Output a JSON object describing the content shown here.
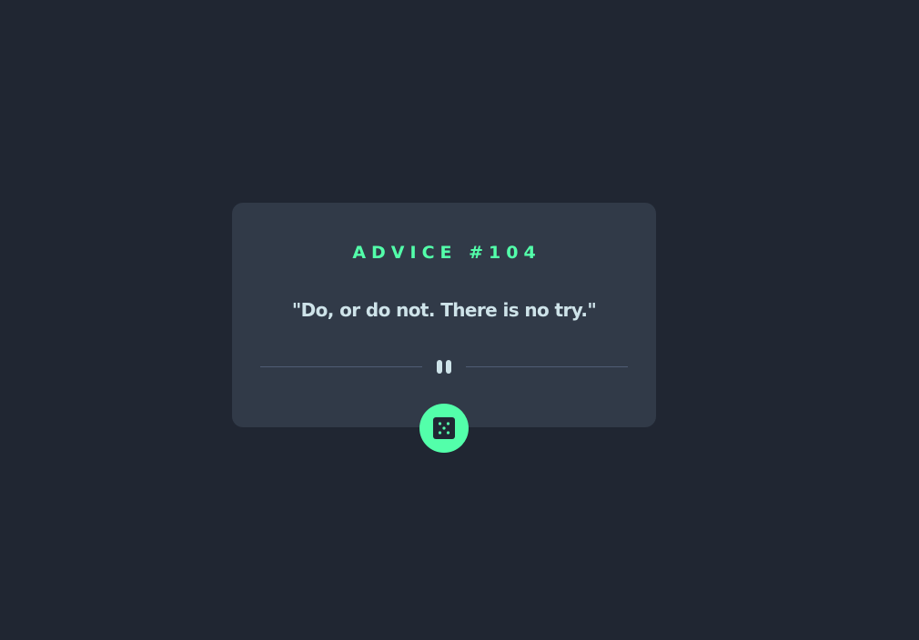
{
  "advice": {
    "id_label": "ADVICE #104",
    "quote": "\"Do, or do not. There is no try.\""
  },
  "divider": {
    "icon": "pause-icon"
  },
  "dice_button": {
    "icon": "dice-icon"
  },
  "colors": {
    "background": "#202632",
    "card": "#313A48",
    "accent": "#53FFAA",
    "text": "#CEE3E9",
    "divider_line": "#4F5D74"
  }
}
